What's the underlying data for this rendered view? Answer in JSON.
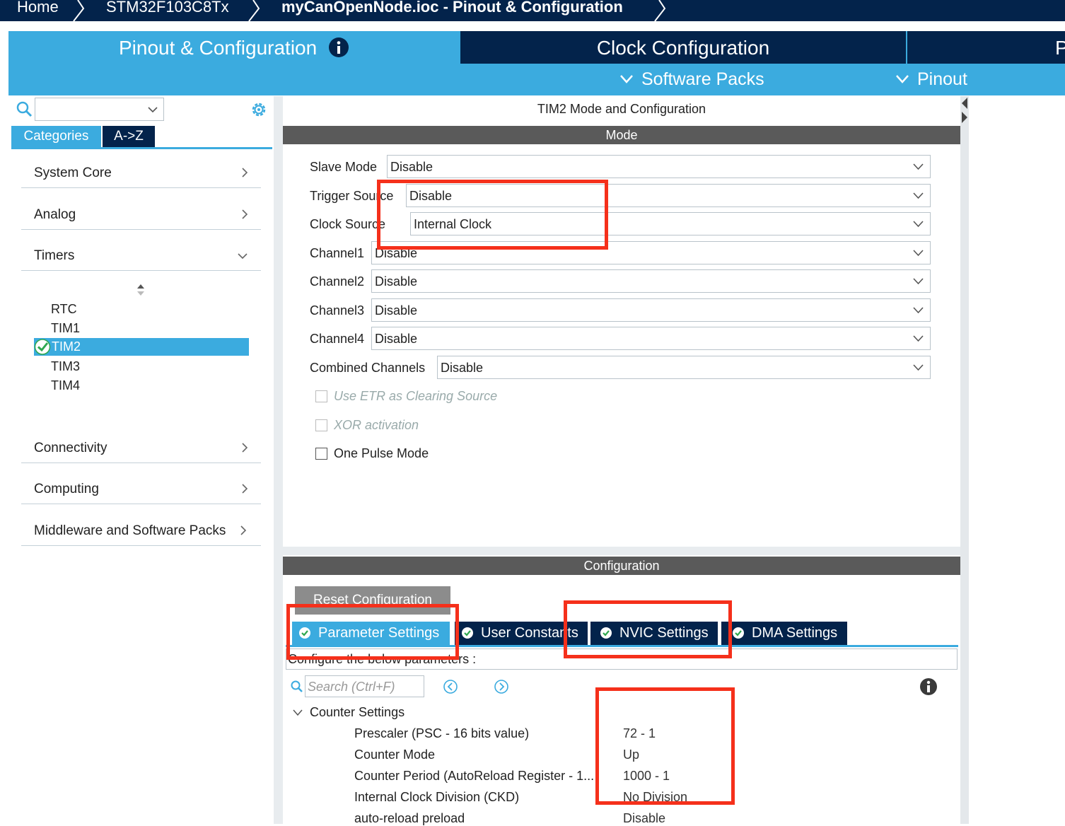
{
  "breadcrumb": [
    "Home",
    "STM32F103C8Tx",
    "myCanOpenNode.ioc - Pinout & Configuration"
  ],
  "top_tabs": {
    "pinout": "Pinout & Configuration",
    "clock": "Clock Configuration",
    "next": "P",
    "software_packs": "Software Packs",
    "pinout_menu": "Pinout"
  },
  "left": {
    "search_placeholder": "",
    "tabs": [
      "Categories",
      "A->Z"
    ],
    "categories": [
      "System Core",
      "Analog",
      "Timers",
      "Connectivity",
      "Computing",
      "Middleware and Software Packs"
    ],
    "timers": [
      "RTC",
      "TIM1",
      "TIM2",
      "TIM3",
      "TIM4"
    ],
    "selected_timer": "TIM2"
  },
  "mode_section": {
    "title": "TIM2 Mode and Configuration",
    "header": "Mode",
    "rows": [
      {
        "label": "Slave Mode",
        "value": "Disable"
      },
      {
        "label": "Trigger Source",
        "value": "Disable"
      },
      {
        "label": "Clock Source",
        "value": "Internal Clock"
      },
      {
        "label": "Channel1",
        "value": "Disable"
      },
      {
        "label": "Channel2",
        "value": "Disable"
      },
      {
        "label": "Channel3",
        "value": "Disable"
      },
      {
        "label": "Channel4",
        "value": "Disable"
      },
      {
        "label": "Combined Channels",
        "value": "Disable"
      }
    ],
    "checkboxes": [
      {
        "label": "Use ETR as Clearing Source",
        "enabled": false,
        "checked": false
      },
      {
        "label": "XOR activation",
        "enabled": false,
        "checked": false
      },
      {
        "label": "One Pulse Mode",
        "enabled": true,
        "checked": false
      }
    ]
  },
  "config_section": {
    "header": "Configuration",
    "reset_button": "Reset Configuration",
    "tabs": [
      "Parameter Settings",
      "User Constants",
      "NVIC Settings",
      "DMA Settings"
    ],
    "params_hint": "Configure the below parameters :",
    "search_placeholder": "Search (Ctrl+F)",
    "group": "Counter Settings",
    "params": [
      {
        "label": "Prescaler (PSC - 16 bits value)",
        "value": "72 - 1"
      },
      {
        "label": "Counter Mode",
        "value": "Up"
      },
      {
        "label": "Counter Period (AutoReload Register - 1...",
        "value": "1000 - 1"
      },
      {
        "label": "Internal Clock Division (CKD)",
        "value": "No Division"
      },
      {
        "label": "auto-reload preload",
        "value": "Disable"
      }
    ]
  },
  "colors": {
    "nav_dark": "#03234b",
    "accent_blue": "#3babdf",
    "highlight_red": "#f5301b"
  }
}
